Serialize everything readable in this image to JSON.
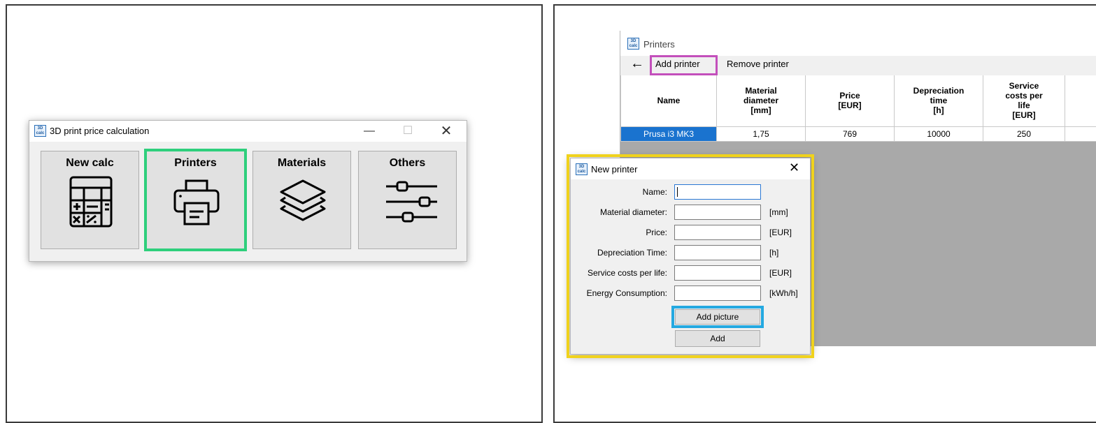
{
  "main_window": {
    "title": "3D print price calculation",
    "app_icon_text": [
      "3D",
      "calc"
    ],
    "buttons": [
      {
        "label": "New calc",
        "icon": "calculator-icon"
      },
      {
        "label": "Printers",
        "icon": "printer-icon"
      },
      {
        "label": "Materials",
        "icon": "layers-icon"
      },
      {
        "label": "Others",
        "icon": "sliders-icon"
      }
    ]
  },
  "printers_window": {
    "title": "Printers",
    "toolbar": {
      "back_icon": "back-arrow-icon",
      "add_label": "Add printer",
      "remove_label": "Remove printer"
    },
    "table": {
      "headers": [
        "Name",
        "Material\ndiameter\n[mm]",
        "Price\n[EUR]",
        "Depreciation\ntime\n[h]",
        "Service\ncosts per\nlife\n[EUR]"
      ],
      "rows": [
        [
          "Prusa i3 MK3",
          "1,75",
          "769",
          "10000",
          "250"
        ]
      ]
    }
  },
  "new_printer_dialog": {
    "title": "New printer",
    "fields": [
      {
        "label": "Name:",
        "value": "",
        "unit": ""
      },
      {
        "label": "Material diameter:",
        "value": "",
        "unit": "[mm]"
      },
      {
        "label": "Price:",
        "value": "",
        "unit": "[EUR]"
      },
      {
        "label": "Depreciation Time:",
        "value": "",
        "unit": "[h]"
      },
      {
        "label": "Service costs per life:",
        "value": "",
        "unit": "[EUR]"
      },
      {
        "label": "Energy Consumption:",
        "value": "",
        "unit": "[kWh/h]"
      }
    ],
    "add_picture_label": "Add picture",
    "add_label": "Add"
  },
  "highlight_colors": {
    "printers_button": "#2ecf7c",
    "add_printer": "#c34fbb",
    "dialog": "#f0d21c",
    "add_picture": "#24a9e1"
  },
  "selection_color": "#1a73cf"
}
